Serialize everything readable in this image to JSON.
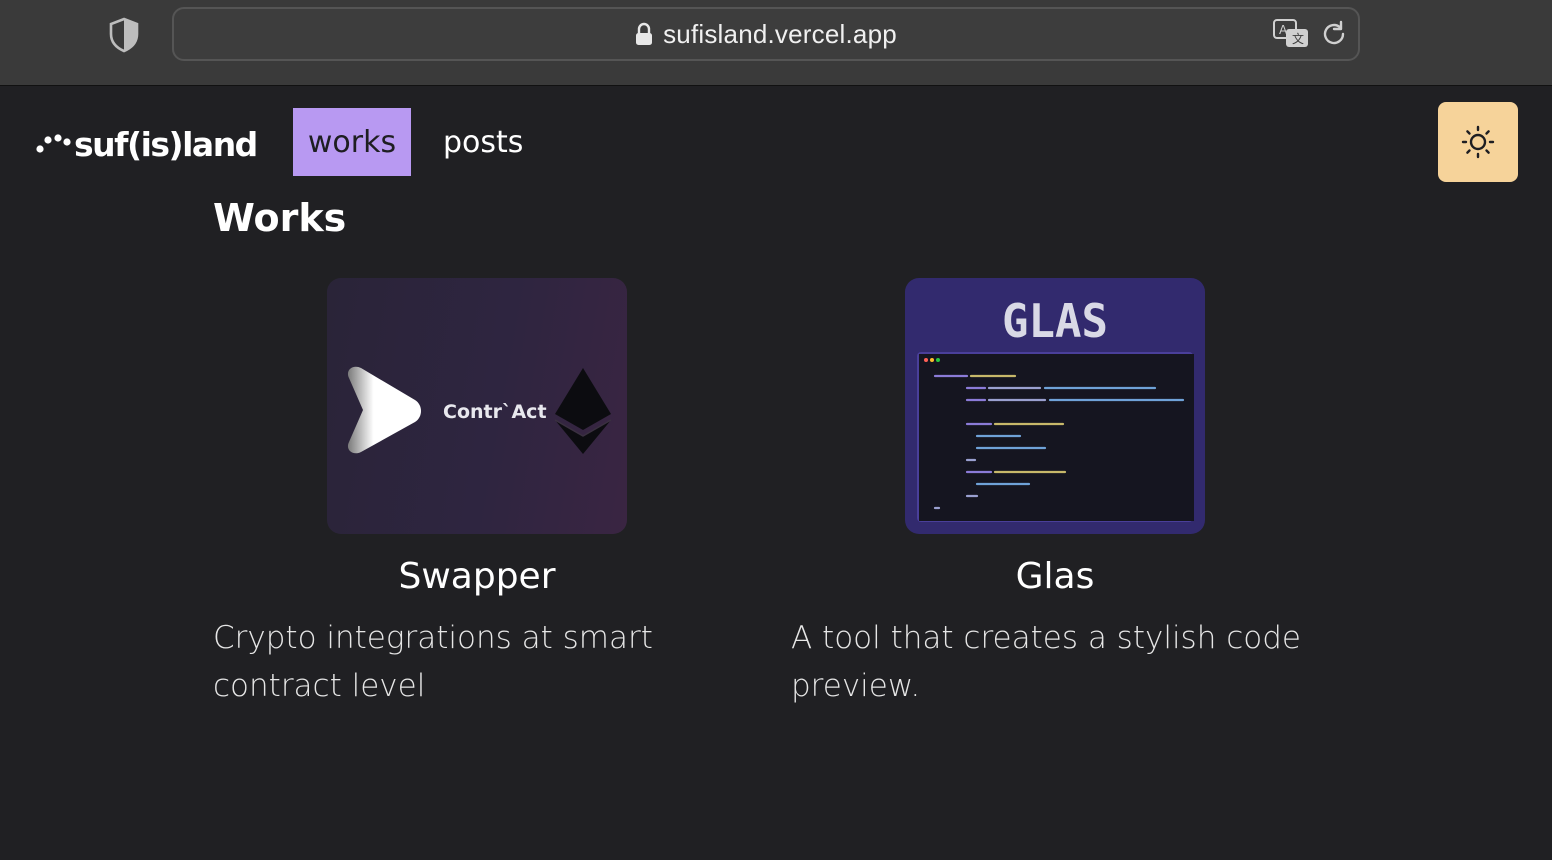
{
  "browser": {
    "url": "sufisland.vercel.app"
  },
  "site": {
    "logo_text": "suf(is)land",
    "nav": {
      "works_label": "works",
      "posts_label": "posts"
    }
  },
  "page": {
    "title": "Works"
  },
  "works": [
    {
      "title": "Swapper",
      "description": "Crypto integrations at smart contract level",
      "thumbnail_text": "Contr`Act"
    },
    {
      "title": "Glas",
      "description": "A tool that creates a stylish code preview.",
      "thumbnail_text": "GLAS"
    }
  ],
  "colors": {
    "background": "#202023",
    "nav_active": "#b899f2",
    "theme_toggle": "#f6d39a",
    "glas_thumb": "#322a6e"
  },
  "icons": [
    "shield-icon",
    "lock-icon",
    "translate-icon",
    "reload-icon",
    "sun-icon",
    "play-logo-icon",
    "ethereum-icon"
  ]
}
